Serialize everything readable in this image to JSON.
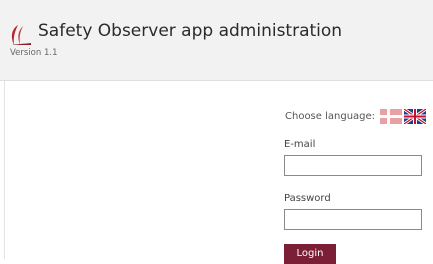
{
  "header": {
    "title": "Safety Observer app administration",
    "version": "Version 1.1",
    "logo_icon": "red-swoosh-logo",
    "background": "#f2f2f2"
  },
  "language": {
    "label": "Choose language:",
    "options": [
      {
        "name": "Danish",
        "icon": "danish-flag-icon"
      },
      {
        "name": "English",
        "icon": "uk-flag-icon"
      }
    ]
  },
  "form": {
    "email_label": "E-mail",
    "email_value": "",
    "password_label": "Password",
    "password_value": "",
    "login_label": "Login"
  },
  "colors": {
    "accent": "#7a1f35",
    "logo": "#b3262e"
  }
}
